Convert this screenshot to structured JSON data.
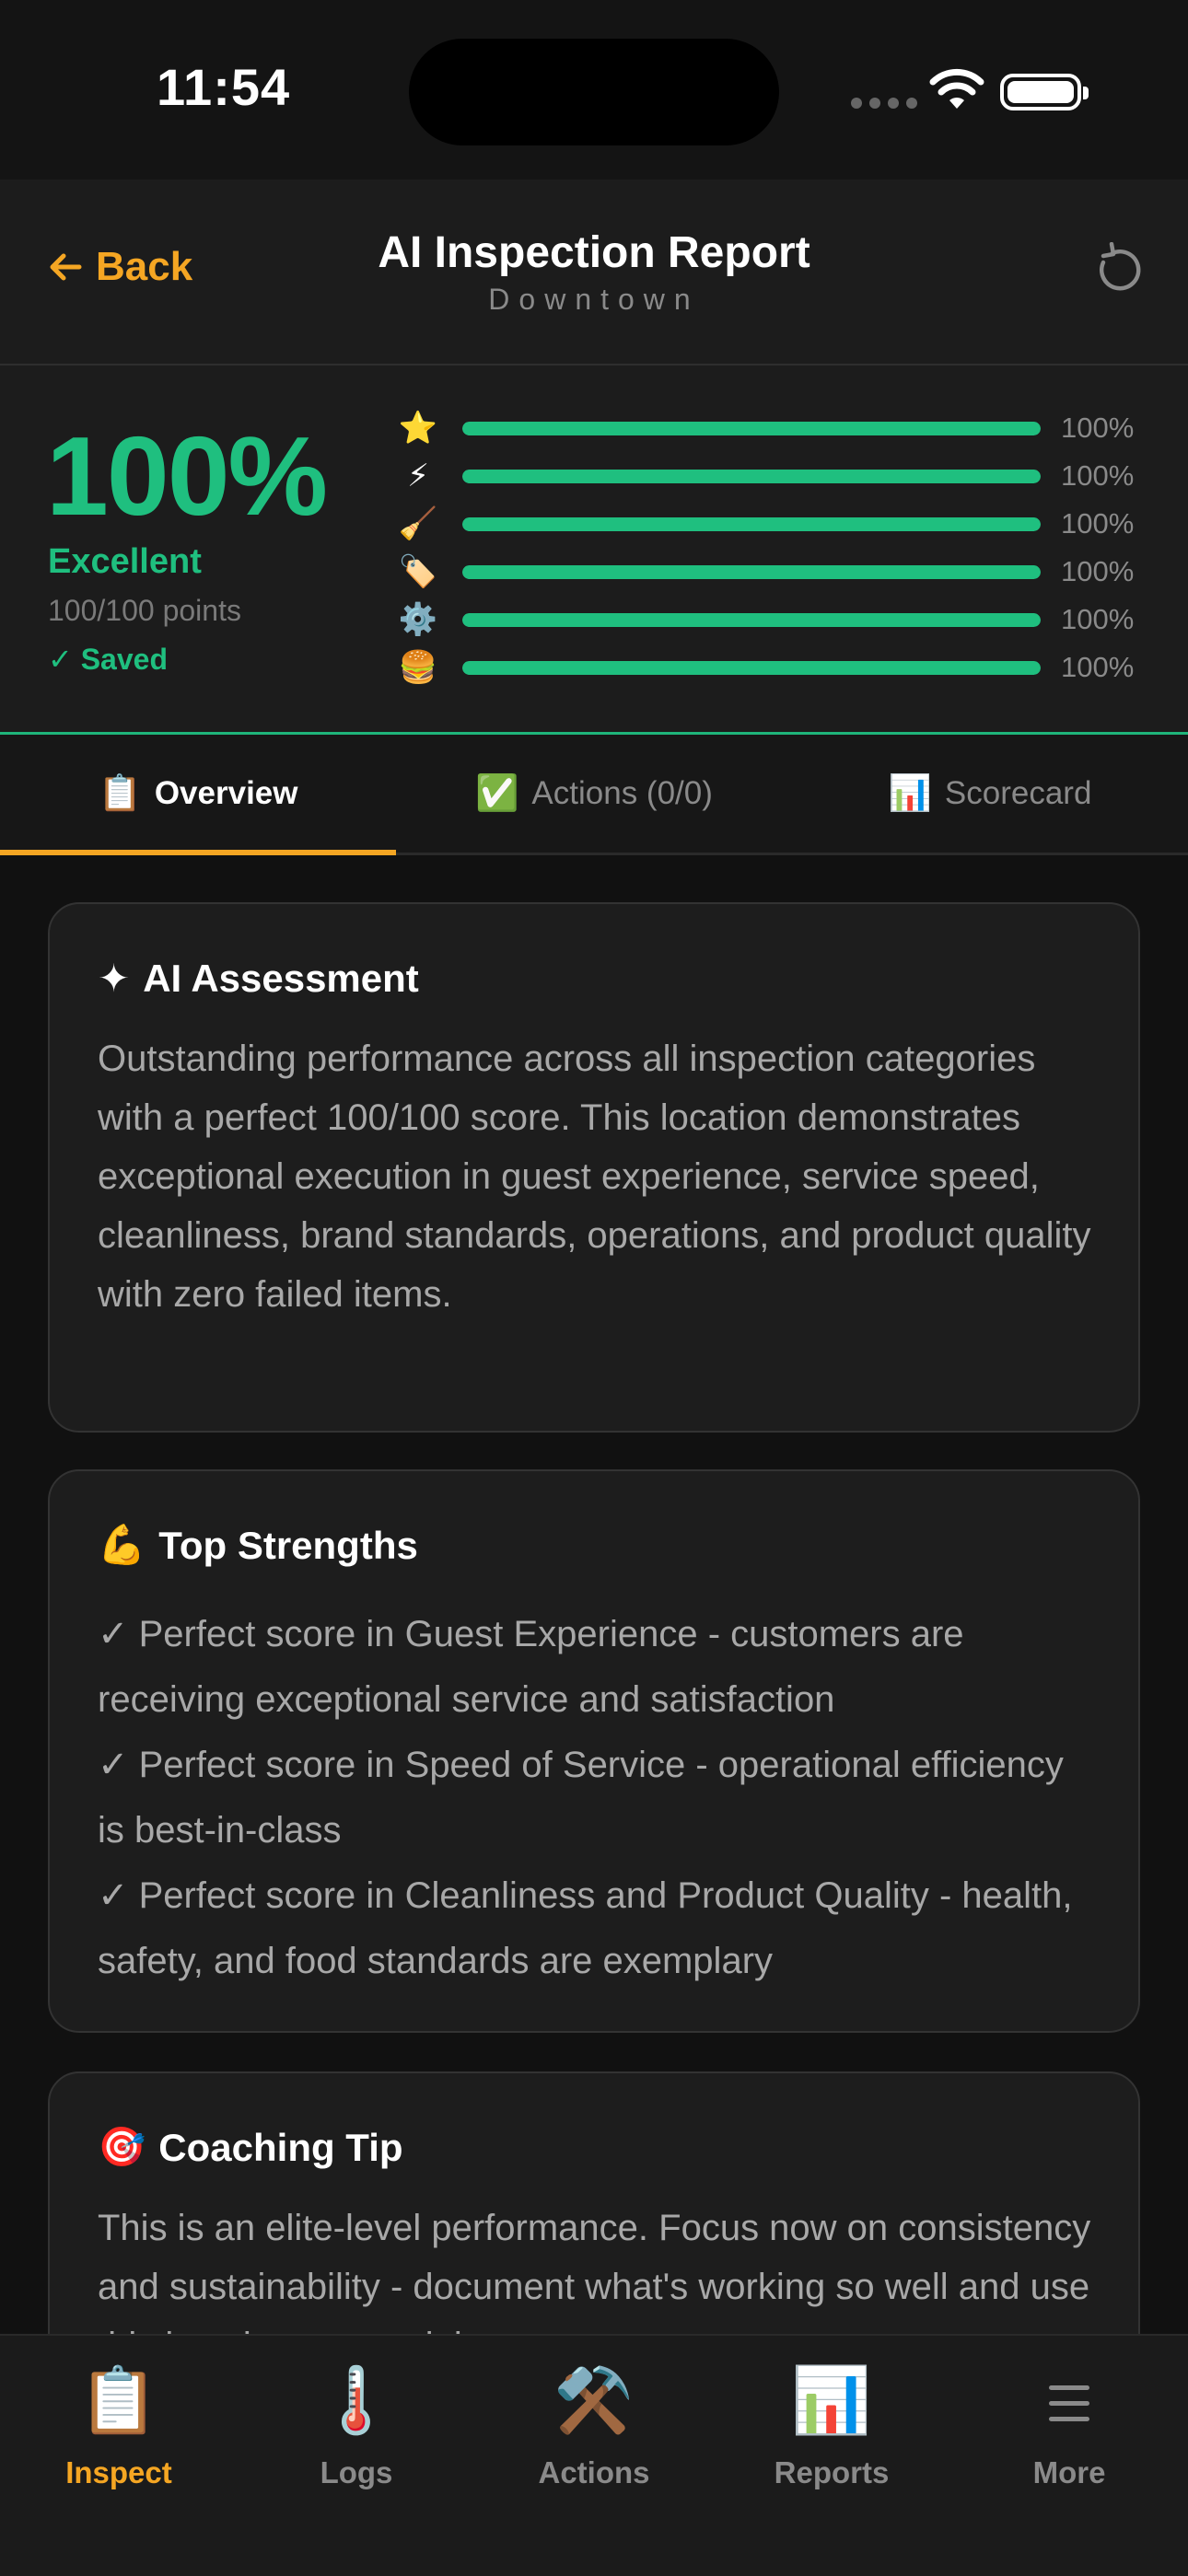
{
  "status_bar": {
    "time": "11:54"
  },
  "header": {
    "back_label": "Back",
    "title": "AI Inspection Report",
    "subtitle": "Downtown"
  },
  "score": {
    "percent": "100%",
    "grade": "Excellent",
    "points": "100/100 points",
    "saved": "✓ Saved",
    "categories": [
      {
        "icon": "⭐",
        "name": "guest-experience",
        "value": 100,
        "label": "100%"
      },
      {
        "icon": "⚡",
        "name": "speed-of-service",
        "value": 100,
        "label": "100%"
      },
      {
        "icon": "🧹",
        "name": "cleanliness",
        "value": 100,
        "label": "100%"
      },
      {
        "icon": "🏷️",
        "name": "brand-standards",
        "value": 100,
        "label": "100%"
      },
      {
        "icon": "⚙️",
        "name": "operations",
        "value": 100,
        "label": "100%"
      },
      {
        "icon": "🍔",
        "name": "product-quality",
        "value": 100,
        "label": "100%"
      }
    ],
    "accent_color": "#1fbf7f"
  },
  "tabs": [
    {
      "icon": "📋",
      "label": "Overview",
      "active": true
    },
    {
      "icon": "✅",
      "label": "Actions (0/0)",
      "active": false
    },
    {
      "icon": "📊",
      "label": "Scorecard",
      "active": false
    }
  ],
  "cards": {
    "assessment": {
      "icon": "✦",
      "title": "AI Assessment",
      "body": "Outstanding performance across all inspection categories with a perfect 100/100 score. This location demonstrates exceptional execution in guest experience, service speed, cleanliness, brand standards, operations, and product quality with zero failed items."
    },
    "strengths": {
      "icon": "💪",
      "title": "Top Strengths",
      "items": [
        "✓ Perfect score in Guest Experience - customers are receiving exceptional service and satisfaction",
        "✓ Perfect score in Speed of Service - operational efficiency is best-in-class",
        "✓ Perfect score in Cleanliness and Product Quality - health, safety, and food standards are exemplary"
      ]
    },
    "coaching": {
      "icon": "🎯",
      "title": "Coaching Tip",
      "body": "This is an elite-level performance. Focus now on consistency and sustainability - document what's working so well and use this location as a training"
    }
  },
  "tab_bar": [
    {
      "icon": "📋",
      "label": "Inspect",
      "active": true
    },
    {
      "icon": "🌡️",
      "label": "Logs",
      "active": false
    },
    {
      "icon": "⚒️",
      "label": "Actions",
      "active": false
    },
    {
      "icon": "📊",
      "label": "Reports",
      "active": false
    },
    {
      "icon": "menu-icon",
      "label": "More",
      "active": false
    }
  ],
  "colors": {
    "accent_orange": "#f5a623",
    "success_green": "#1fbf7f"
  }
}
